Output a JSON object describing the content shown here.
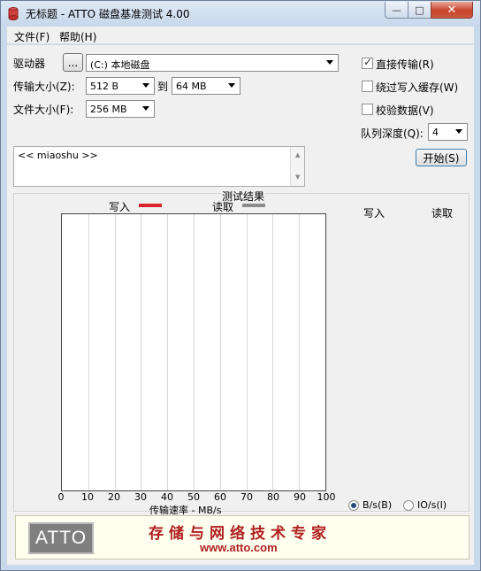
{
  "window": {
    "title": "无标题 - ATTO 磁盘基准测试 4.00",
    "minimize": "—",
    "maximize": "□",
    "close": "✕"
  },
  "menu": {
    "file": "文件(F)",
    "help": "帮助(H)"
  },
  "form": {
    "drive_label": "驱动器",
    "browse_label": "...",
    "drive_value": "(C:) 本地磁盘",
    "transfer_size_label": "传输大小(Z):",
    "transfer_from": "512 B",
    "to_label": "到",
    "transfer_to": "64 MB",
    "file_size_label": "文件大小(F):",
    "file_size": "256 MB",
    "direct_io_label": "直接传输(R)",
    "bypass_cache_label": "绕过写入缓存(W)",
    "verify_label": "校验数据(V)",
    "queue_depth_label": "队列深度(Q):",
    "queue_depth": "4",
    "start_label": "开始(S)",
    "description": "<< miaoshu >>"
  },
  "results": {
    "title": "测试结果",
    "legend_write": "写入",
    "legend_read": "读取",
    "col_write": "写入",
    "col_read": "读取",
    "xlabel": "传输速率 - MB/s",
    "write_color": "#d9262b",
    "read_color": "#8c8c8c",
    "ticks": [
      "0",
      "10",
      "20",
      "30",
      "40",
      "50",
      "60",
      "70",
      "80",
      "90",
      "100"
    ],
    "unit_bytes": "B/s(B)",
    "unit_io": "IO/s(I)"
  },
  "banner": {
    "logo": "ATTO",
    "slogan": "存储与网络技术专家",
    "url": "www.atto.com"
  }
}
